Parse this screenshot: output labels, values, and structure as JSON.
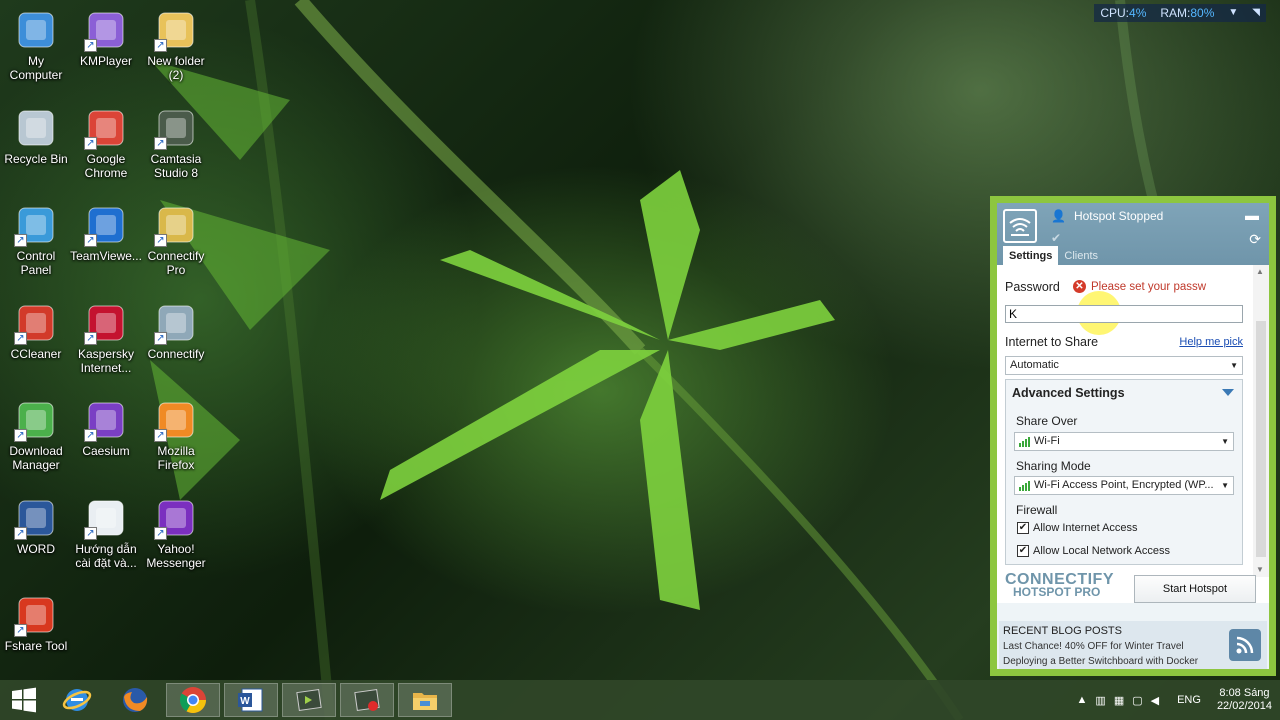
{
  "sysmon": {
    "cpu_label": "CPU:",
    "cpu_value": "4%",
    "ram_label": "RAM:",
    "ram_value": "80%"
  },
  "desktop": {
    "icons": [
      {
        "label": "My Computer",
        "icon": "computer-icon"
      },
      {
        "label": "KMPlayer",
        "icon": "kmplayer-icon"
      },
      {
        "label": "New folder (2)",
        "icon": "folder-icon"
      },
      {
        "label": "Recycle Bin",
        "icon": "recycle-bin-icon"
      },
      {
        "label": "Google Chrome",
        "icon": "chrome-icon"
      },
      {
        "label": "Camtasia Studio 8",
        "icon": "camtasia-icon"
      },
      {
        "label": "Control Panel",
        "icon": "control-panel-icon"
      },
      {
        "label": "TeamViewe...",
        "icon": "teamviewer-icon"
      },
      {
        "label": "Connectify Pro",
        "icon": "connectify-pro-icon"
      },
      {
        "label": "CCleaner",
        "icon": "ccleaner-icon"
      },
      {
        "label": "Kaspersky Internet...",
        "icon": "kaspersky-icon"
      },
      {
        "label": "Connectify",
        "icon": "connectify-icon"
      },
      {
        "label": "Download Manager",
        "icon": "download-manager-icon"
      },
      {
        "label": "Caesium",
        "icon": "caesium-icon"
      },
      {
        "label": "Mozilla Firefox",
        "icon": "firefox-icon"
      },
      {
        "label": "WORD",
        "icon": "word-icon"
      },
      {
        "label": "Hướng dẫn cài đặt và...",
        "icon": "document-icon"
      },
      {
        "label": "Yahoo! Messenger",
        "icon": "yahoo-messenger-icon"
      },
      {
        "label": "Fshare Tool",
        "icon": "fshare-icon"
      }
    ]
  },
  "hotspot": {
    "status": "Hotspot Stopped",
    "tabs": [
      "Settings",
      "Clients"
    ],
    "password_label": "Password",
    "password_error": "Please set your passw",
    "password_value": "K",
    "internet_label": "Internet to Share",
    "help_link": "Help me pick",
    "internet_value": "Automatic",
    "advanced_title": "Advanced Settings",
    "share_over_label": "Share Over",
    "share_over_value": "Wi-Fi",
    "sharing_mode_label": "Sharing Mode",
    "sharing_mode_value": "Wi-Fi Access Point, Encrypted (WP...",
    "firewall_label": "Firewall",
    "allow_internet": "Allow Internet Access",
    "allow_local": "Allow Local Network Access",
    "brand_line1": "CONNECTIFY",
    "brand_line2": "HOTSPOT PRO",
    "start_button": "Start Hotspot",
    "blog_title": "RECENT BLOG POSTS",
    "blog_post_1": "Last Chance! 40% OFF for Winter Travel",
    "blog_post_2": "Deploying a Better Switchboard with Docker"
  },
  "taskbar": {
    "apps": [
      "start-icon",
      "internet-explorer-icon",
      "firefox-icon",
      "chrome-icon",
      "word-icon",
      "camtasia-icon",
      "camtasia-recorder-icon",
      "file-explorer-icon"
    ],
    "language": "ENG",
    "time": "8:08 Sáng",
    "date": "22/02/2014"
  },
  "colors": {
    "accent_green": "#8dc63f",
    "header_blue": "#6f95aa",
    "error_red": "#d43b2a"
  }
}
